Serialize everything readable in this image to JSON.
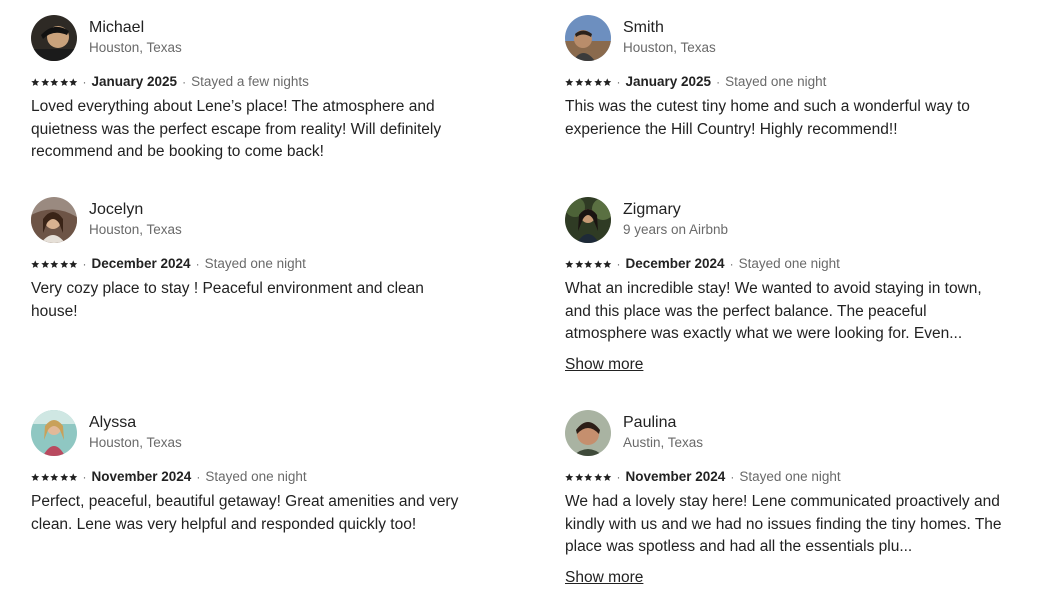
{
  "reviews": [
    {
      "name": "Michael",
      "location": "Houston, Texas",
      "rating": 5,
      "date": "January 2025",
      "stay": "Stayed a few nights",
      "text": "Loved everything about Lene’s place! The atmosphere and quietness was the perfect escape from reality! Will definitely recommend and be booking to come back!",
      "show_more": ""
    },
    {
      "name": "Smith",
      "location": "Houston, Texas",
      "rating": 5,
      "date": "January 2025",
      "stay": "Stayed one night",
      "text": "This was the cutest tiny home and such a wonderful way to experience the Hill Country! Highly recommend!!",
      "show_more": ""
    },
    {
      "name": "Jocelyn",
      "location": "Houston, Texas",
      "rating": 5,
      "date": "December 2024",
      "stay": "Stayed one night",
      "text": "Very cozy place to stay ! Peaceful environment and clean house!",
      "show_more": ""
    },
    {
      "name": "Zigmary",
      "location": "9 years on Airbnb",
      "rating": 5,
      "date": "December 2024",
      "stay": "Stayed one night",
      "text": "What an incredible stay! We wanted to avoid staying in town, and this place was the perfect balance. The peaceful atmosphere was exactly what we were looking for. Even...",
      "show_more": "Show more"
    },
    {
      "name": "Alyssa",
      "location": "Houston, Texas",
      "rating": 5,
      "date": "November 2024",
      "stay": "Stayed one night",
      "text": "Perfect, peaceful, beautiful getaway! Great amenities and very clean. Lene was very helpful and responded quickly too!",
      "show_more": ""
    },
    {
      "name": "Paulina",
      "location": "Austin, Texas",
      "rating": 5,
      "date": "November 2024",
      "stay": "Stayed one night",
      "text": "We had a lovely stay here! Lene communicated proactively and kindly with us and we had no issues finding the tiny homes. The place was spotless and had all the essentials plu...",
      "show_more": "Show more"
    }
  ],
  "separator": "·",
  "colors": {
    "text": "#222222",
    "secondary": "#6a6a6a"
  },
  "icons": {
    "star": "star-icon",
    "avatar": "avatar-photo"
  }
}
